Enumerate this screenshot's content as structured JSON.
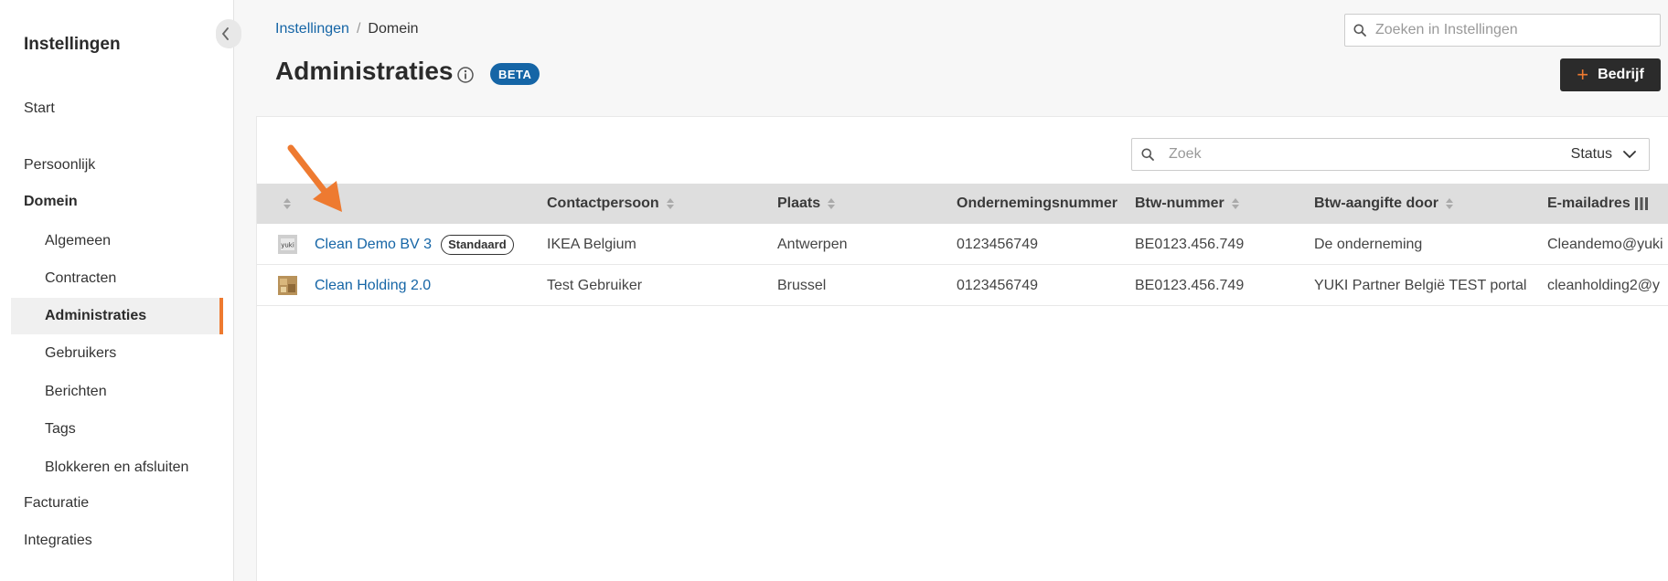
{
  "sidebar": {
    "title": "Instellingen",
    "items": {
      "start": "Start",
      "persoonlijk": "Persoonlijk",
      "domein": "Domein",
      "algemeen": "Algemeen",
      "contracten": "Contracten",
      "administraties": "Administraties",
      "gebruikers": "Gebruikers",
      "berichten": "Berichten",
      "tags": "Tags",
      "blokkeren": "Blokkeren en afsluiten",
      "facturatie": "Facturatie",
      "integraties": "Integraties"
    },
    "active_color": "#ee7a30"
  },
  "header": {
    "breadcrumb_root": "Instellingen",
    "breadcrumb_separator": "/",
    "breadcrumb_current": "Domein",
    "search_placeholder": "Zoeken in Instellingen",
    "title": "Administraties",
    "badge": "BETA",
    "add_button": "Bedrijf"
  },
  "table": {
    "search_placeholder": "Zoek",
    "status_label": "Status",
    "columns": {
      "contact": "Contactpersoon",
      "place": "Plaats",
      "company_number": "Ondernemingsnummer",
      "vat_number": "Btw-nummer",
      "vat_by": "Btw-aangifte door",
      "email": "E-mailadres"
    },
    "rows": [
      {
        "name": "Clean Demo BV 3",
        "badge": "Standaard",
        "contact": "IKEA Belgium",
        "place": "Antwerpen",
        "company_number": "0123456749",
        "vat_number": "BE0123.456.749",
        "vat_by": "De onderneming",
        "email": "Cleandemo@yuki"
      },
      {
        "name": "Clean Holding 2.0",
        "contact": "Test Gebruiker",
        "place": "Brussel",
        "company_number": "0123456749",
        "vat_number": "BE0123.456.749",
        "vat_by": "YUKI Partner België TEST portal",
        "email": "cleanholding2@y"
      }
    ]
  },
  "colors": {
    "link": "#1565a6",
    "accent": "#ee7a30",
    "dark_button": "#2b2b2b",
    "header_bg": "#dedede"
  },
  "icons": {
    "search": "search-icon",
    "info": "info-icon",
    "chevron_left": "chevron-left-icon",
    "chevron_down": "chevron-down-icon",
    "sort": "sort-icon",
    "columns": "columns-icon",
    "plus": "plus-icon",
    "annotation_arrow": "arrow-icon"
  }
}
